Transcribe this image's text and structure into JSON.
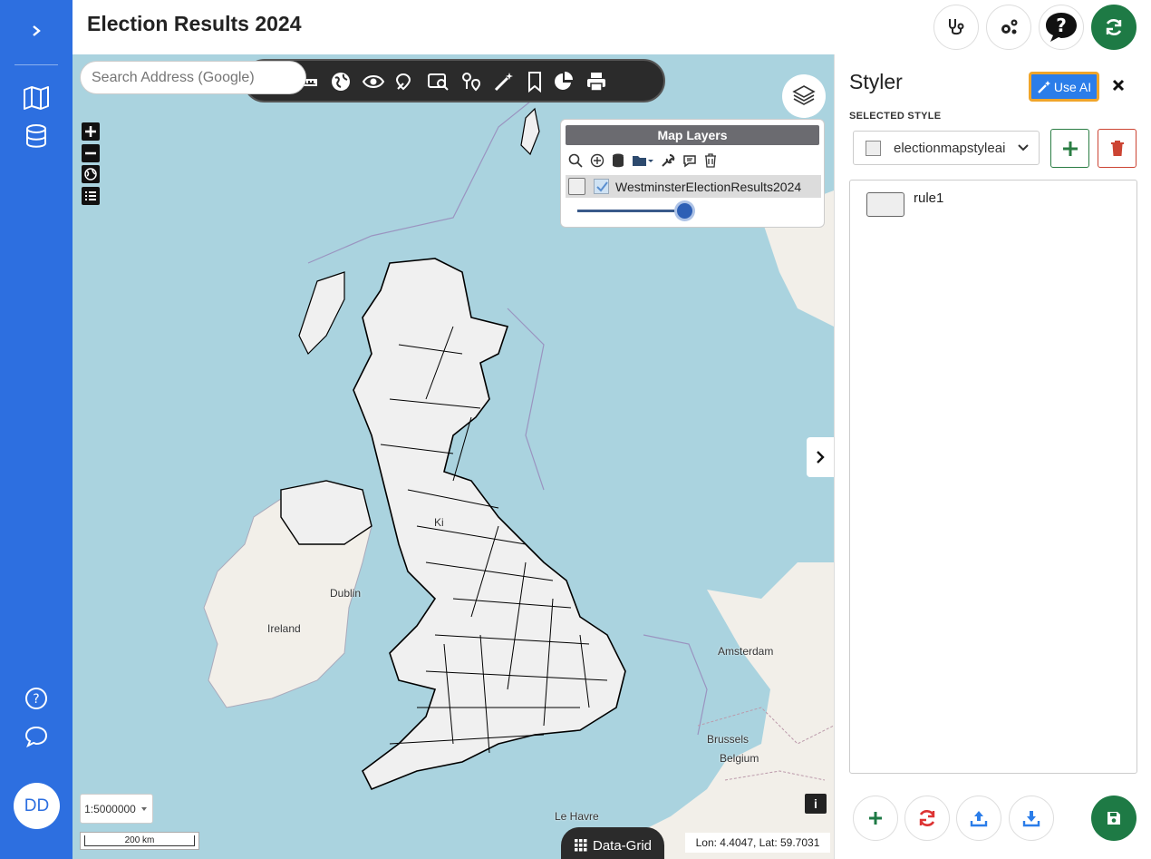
{
  "app": {
    "title": "Election Results 2024"
  },
  "sidebar": {
    "avatar_initials": "DD"
  },
  "map": {
    "search_placeholder": "Search Address (Google)",
    "layers_panel": {
      "title": "Map Layers",
      "layer_name": "WestminsterElectionResults2024",
      "opacity": 1.0
    },
    "places": {
      "dublin": "Dublin",
      "ireland": "Ireland",
      "amsterdam": "Amsterdam",
      "brussels": "Brussels",
      "belgium": "Belgium",
      "le_havre": "Le Havre",
      "kingdom_fragment": "Ki"
    },
    "scale": {
      "selector": "1:5000000",
      "bar_label": "200 km"
    },
    "data_grid_label": "Data-Grid",
    "coordinates": "Lon: 4.4047, Lat: 59.7031",
    "info_label": "i"
  },
  "styler": {
    "title": "Styler",
    "use_ai_label": "Use AI",
    "selected_style_label": "SELECTED STYLE",
    "selected_style_value": "electionmapstyleai",
    "rules": [
      {
        "name": "rule1"
      }
    ]
  },
  "colors": {
    "sidebar": "#2d6fe0",
    "accent_green": "#1e7a45",
    "danger_red": "#cc3344",
    "ai_button": "#2b7de9",
    "ai_border": "#f0a52a",
    "sea": "#aad3df"
  }
}
